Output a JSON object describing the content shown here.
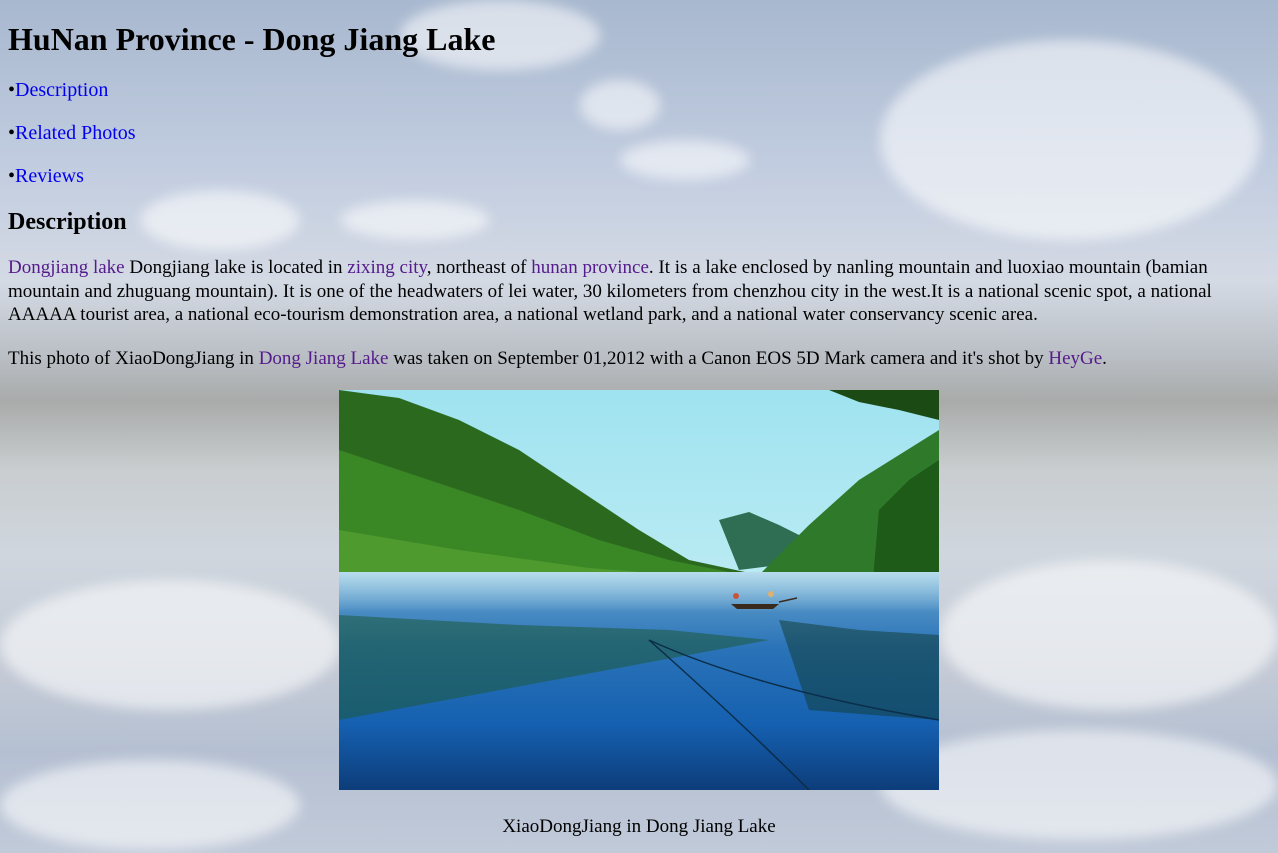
{
  "page": {
    "title": "HuNan Province - Dong Jiang Lake"
  },
  "nav": [
    {
      "bullet": "•",
      "label": "Description"
    },
    {
      "bullet": "•",
      "label": "Related Photos"
    },
    {
      "bullet": "•",
      "label": "Reviews"
    }
  ],
  "description": {
    "heading": "Description",
    "link_lake": "Dongjiang lake",
    "text_1": " Dongjiang lake is located in ",
    "link_city": "zixing city",
    "text_2": ", northeast of ",
    "link_province": "hunan province",
    "text_3": ". It is a lake enclosed by nanling mountain and luoxiao mountain (bamian mountain and zhuguang mountain). It is one of the headwaters of lei water, 30 kilometers from chenzhou city in the west.It is a national scenic spot, a national AAAAA tourist area, a national eco-tourism demonstration area, a national wetland park, and a national water conservancy scenic area."
  },
  "photo_info": {
    "text_1": "This photo of XiaoDongJiang in ",
    "link_lake": "Dong Jiang Lake",
    "text_2": " was taken on September 01,2012 with a Canon EOS 5D Mark camera and it's shot by ",
    "link_author": "HeyGe",
    "text_3": "."
  },
  "photo": {
    "caption": "XiaoDongJiang in Dong Jiang Lake"
  },
  "colors": {
    "link": "#0000ee",
    "visited_link": "#551a8b"
  }
}
